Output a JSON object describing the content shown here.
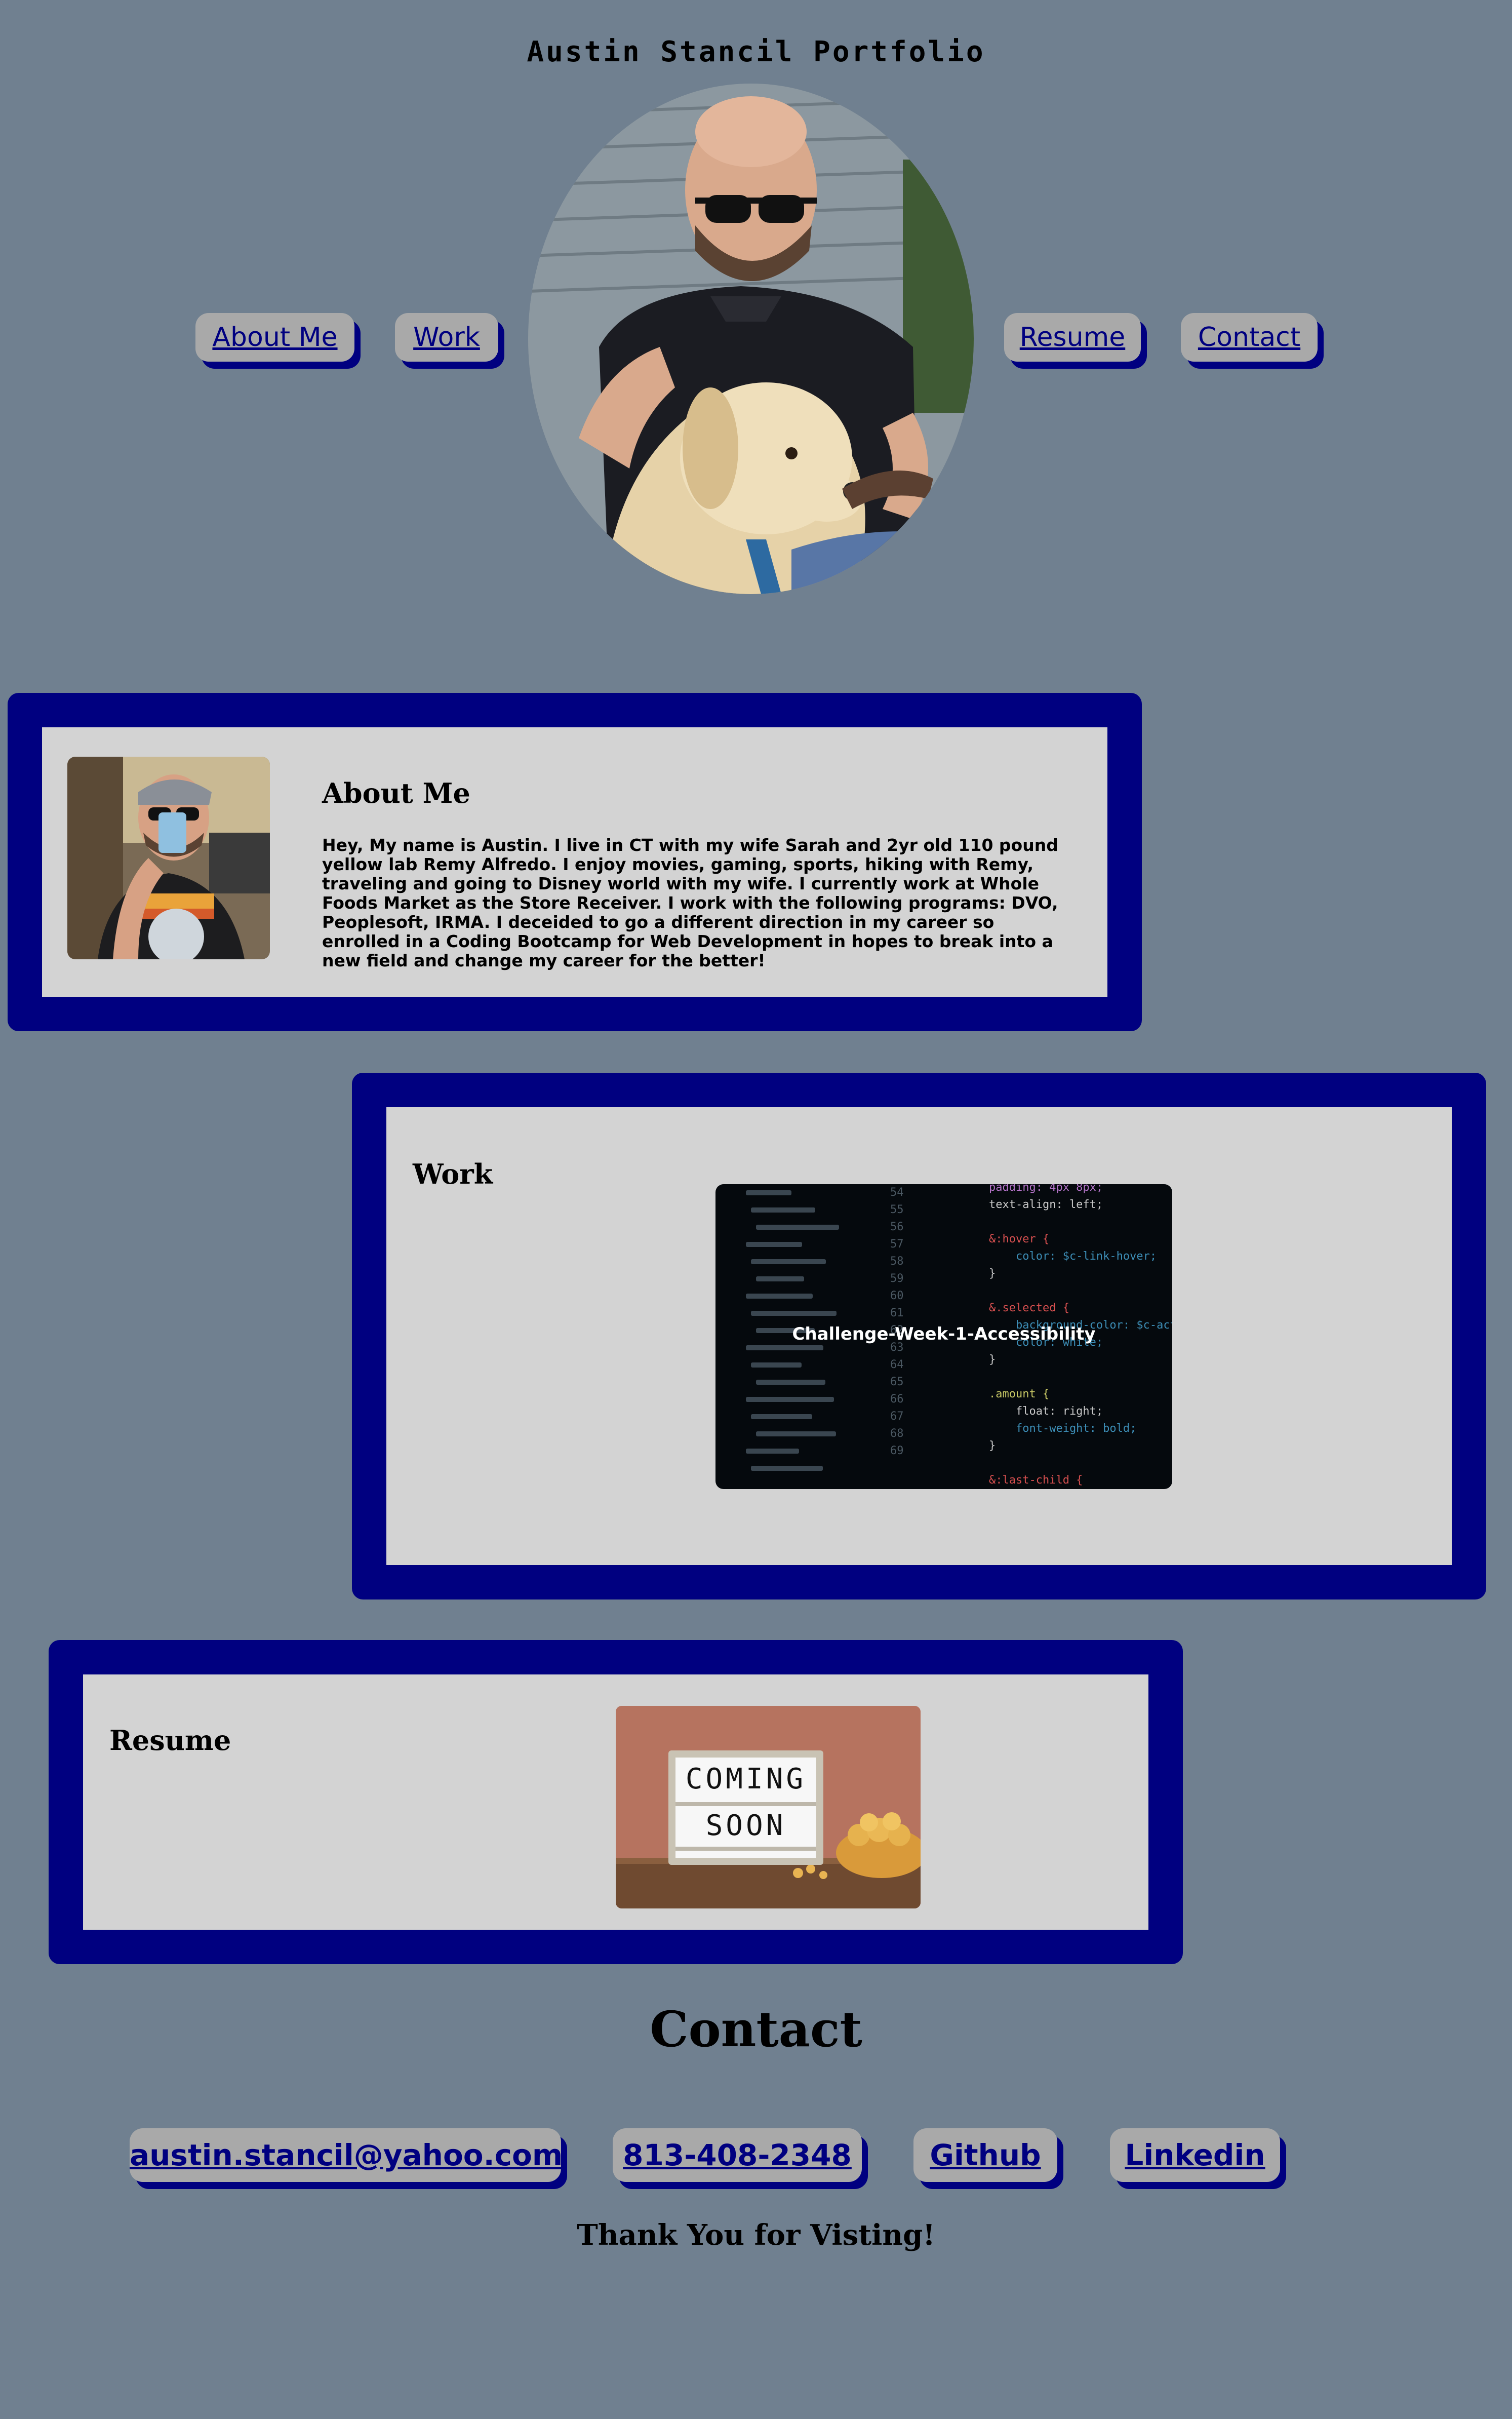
{
  "site_title": "Austin Stancil Portfolio",
  "nav": {
    "about": "About Me",
    "work": "Work",
    "resume": "Resume",
    "contact": "Contact"
  },
  "about": {
    "heading": "About Me",
    "text": "Hey, My name is Austin. I live in CT with my wife Sarah and 2yr old 110 pound yellow lab Remy Alfredo. I enjoy movies, gaming, sports, hiking with Remy, traveling and going to Disney world with my wife. I currently work at Whole Foods Market as the Store Receiver. I work with the following programs: DVO, Peoplesoft, IRMA. I deceided to go a different direction in my career so enrolled in a Coding Bootcamp for Web Development in hopes to break into a new field and change my career for the better!"
  },
  "work": {
    "heading": "Work",
    "project_label": "Challenge-Week-1-Accessibility"
  },
  "resume": {
    "heading": "Resume",
    "sign_line1": "COMING",
    "sign_line2": "SOON"
  },
  "contact": {
    "heading": "Contact",
    "email": "austin.stancil@yahoo.com",
    "phone": "813-408-2348",
    "github": "Github",
    "linkedin": "Linkedin"
  },
  "footer": {
    "thanks": "Thank You for Visting!"
  },
  "code_lines": [
    "padding: 4px 8px;",
    "text-align: left;",
    "",
    "&:hover {",
    "    color: $c-link-hover;",
    "}",
    "",
    "&.selected {",
    "    background-color: $c-action;",
    "    color: white;",
    "}",
    "",
    ".amount {",
    "    float: right;",
    "    font-weight: bold;",
    "}",
    "",
    "&:last-child {"
  ],
  "line_numbers": [
    "54",
    "55",
    "56",
    "57",
    "58",
    "59",
    "60",
    "61",
    "62",
    "63",
    "64",
    "65",
    "66",
    "67",
    "68",
    "69"
  ],
  "colors": {
    "page_bg": "#708090",
    "navy": "#000080",
    "panel": "#d3d3d3",
    "button": "#a9a9a9"
  }
}
